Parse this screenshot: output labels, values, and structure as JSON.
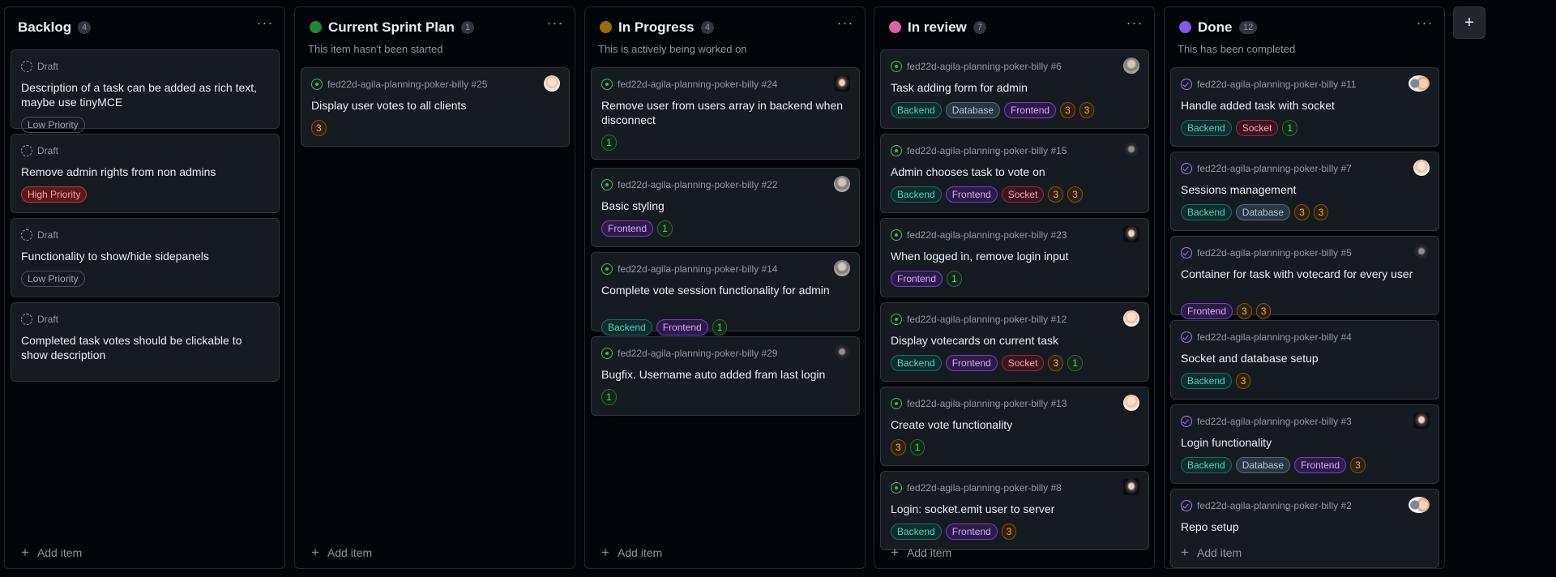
{
  "add_column_label": "+",
  "columns": [
    {
      "title": "Backlog",
      "count": "4",
      "description": "",
      "color": "",
      "menu_label": "···",
      "add_label": "Add item",
      "cards": [
        {
          "status": "draft",
          "meta": "Draft",
          "title": "Description of a task can be added as rich text, maybe use tinyMCE",
          "labels": [
            {
              "text": "Low Priority",
              "kind": "low"
            }
          ]
        },
        {
          "status": "draft",
          "meta": "Draft",
          "title": "Remove admin rights from non admins",
          "labels": [
            {
              "text": "High Priority",
              "kind": "high"
            }
          ]
        },
        {
          "status": "draft",
          "meta": "Draft",
          "title": "Functionality to show/hide sidepanels",
          "labels": [
            {
              "text": "Low Priority",
              "kind": "low"
            }
          ]
        },
        {
          "status": "draft",
          "meta": "Draft",
          "title": "Completed task votes should be clickable to show description",
          "labels": []
        }
      ]
    },
    {
      "title": "Current Sprint Plan",
      "count": "1",
      "description": "This item hasn't been started",
      "color": "#238636",
      "menu_label": "···",
      "add_label": "Add item",
      "cards": [
        {
          "status": "open",
          "meta": "fed22d-agila-planning-poker-billy #25",
          "title": "Display user votes to all clients",
          "avatar": "av-light",
          "labels": [
            {
              "text": "3",
              "kind": "num-orange"
            }
          ]
        }
      ]
    },
    {
      "title": "In Progress",
      "count": "4",
      "description": "This is actively being worked on",
      "color": "#9e6a03",
      "menu_label": "···",
      "add_label": "Add item",
      "cards": [
        {
          "status": "open",
          "meta": "fed22d-agila-planning-poker-billy #24",
          "title": "Remove user from users array in backend when disconnect",
          "avatar": "av-portrait",
          "labels": [
            {
              "text": "1",
              "kind": "num-green"
            }
          ]
        },
        {
          "status": "open",
          "meta": "fed22d-agila-planning-poker-billy #22",
          "title": "Basic styling",
          "avatar": "av-gray",
          "labels": [
            {
              "text": "Frontend",
              "kind": "frontend"
            },
            {
              "text": "1",
              "kind": "num-green"
            }
          ]
        },
        {
          "status": "open",
          "meta": "fed22d-agila-planning-poker-billy #14",
          "title": "Complete vote session functionality for admin",
          "avatar": "av-gray",
          "labels": [
            {
              "text": "Backend",
              "kind": "backend"
            },
            {
              "text": "Frontend",
              "kind": "frontend"
            },
            {
              "text": "1",
              "kind": "num-green"
            }
          ]
        },
        {
          "status": "open",
          "meta": "fed22d-agila-planning-poker-billy #29",
          "title": "Bugfix. Username auto added fram last login",
          "avatar": "av-dark",
          "labels": [
            {
              "text": "1",
              "kind": "num-green"
            }
          ]
        }
      ]
    },
    {
      "title": "In review",
      "count": "7",
      "description": "",
      "color": "#db61a2",
      "menu_label": "···",
      "add_label": "Add item",
      "cards": [
        {
          "status": "open",
          "meta": "fed22d-agila-planning-poker-billy #6",
          "title": "Task adding form for admin",
          "avatar": "av-gray",
          "labels": [
            {
              "text": "Backend",
              "kind": "backend"
            },
            {
              "text": "Database",
              "kind": "database"
            },
            {
              "text": "Frontend",
              "kind": "frontend"
            },
            {
              "text": "3",
              "kind": "num-orange"
            },
            {
              "text": "3",
              "kind": "num-orange"
            }
          ]
        },
        {
          "status": "open",
          "meta": "fed22d-agila-planning-poker-billy #15",
          "title": "Admin chooses task to vote on",
          "avatar": "av-dark",
          "labels": [
            {
              "text": "Backend",
              "kind": "backend"
            },
            {
              "text": "Frontend",
              "kind": "frontend"
            },
            {
              "text": "Socket",
              "kind": "socket"
            },
            {
              "text": "3",
              "kind": "num-orange"
            },
            {
              "text": "3",
              "kind": "num-orange"
            }
          ]
        },
        {
          "status": "open",
          "meta": "fed22d-agila-planning-poker-billy #23",
          "title": "When logged in, remove login input",
          "avatar": "av-portrait",
          "labels": [
            {
              "text": "Frontend",
              "kind": "frontend"
            },
            {
              "text": "1",
              "kind": "num-green"
            }
          ]
        },
        {
          "status": "open",
          "meta": "fed22d-agila-planning-poker-billy #12",
          "title": "Display votecards on current task",
          "avatar": "av-light",
          "labels": [
            {
              "text": "Backend",
              "kind": "backend"
            },
            {
              "text": "Frontend",
              "kind": "frontend"
            },
            {
              "text": "Socket",
              "kind": "socket"
            },
            {
              "text": "3",
              "kind": "num-orange"
            },
            {
              "text": "1",
              "kind": "num-green"
            }
          ]
        },
        {
          "status": "open",
          "meta": "fed22d-agila-planning-poker-billy #13",
          "title": "Create vote functionality",
          "avatar": "av-light",
          "labels": [
            {
              "text": "3",
              "kind": "num-orange"
            },
            {
              "text": "1",
              "kind": "num-green"
            }
          ]
        },
        {
          "status": "open",
          "meta": "fed22d-agila-planning-poker-billy #8",
          "title": "Login: socket.emit user to server",
          "avatar": "av-portrait",
          "labels": [
            {
              "text": "Backend",
              "kind": "backend"
            },
            {
              "text": "Frontend",
              "kind": "frontend"
            },
            {
              "text": "3",
              "kind": "num-orange"
            }
          ]
        }
      ]
    },
    {
      "title": "Done",
      "count": "12",
      "description": "This has been completed",
      "color": "#8957e5",
      "menu_label": "···",
      "add_label": "Add item",
      "cards": [
        {
          "status": "done",
          "meta": "fed22d-agila-planning-poker-billy #11",
          "title": "Handle added task with socket",
          "avatar": "av-pair",
          "labels": [
            {
              "text": "Backend",
              "kind": "backend"
            },
            {
              "text": "Socket",
              "kind": "socket"
            },
            {
              "text": "1",
              "kind": "num-green"
            }
          ]
        },
        {
          "status": "done",
          "meta": "fed22d-agila-planning-poker-billy #7",
          "title": "Sessions management",
          "avatar": "av-light",
          "labels": [
            {
              "text": "Backend",
              "kind": "backend"
            },
            {
              "text": "Database",
              "kind": "database"
            },
            {
              "text": "3",
              "kind": "num-orange"
            },
            {
              "text": "3",
              "kind": "num-orange"
            }
          ]
        },
        {
          "status": "done",
          "meta": "fed22d-agila-planning-poker-billy #5",
          "title": "Container for task with votecard for every user",
          "avatar": "av-dark",
          "labels": [
            {
              "text": "Frontend",
              "kind": "frontend"
            },
            {
              "text": "3",
              "kind": "num-orange"
            },
            {
              "text": "3",
              "kind": "num-orange"
            }
          ]
        },
        {
          "status": "done",
          "meta": "fed22d-agila-planning-poker-billy #4",
          "title": "Socket and database setup",
          "labels": [
            {
              "text": "Backend",
              "kind": "backend"
            },
            {
              "text": "3",
              "kind": "num-orange"
            }
          ]
        },
        {
          "status": "done",
          "meta": "fed22d-agila-planning-poker-billy #3",
          "title": "Login functionality",
          "avatar": "av-portrait",
          "labels": [
            {
              "text": "Backend",
              "kind": "backend"
            },
            {
              "text": "Database",
              "kind": "database"
            },
            {
              "text": "Frontend",
              "kind": "frontend"
            },
            {
              "text": "3",
              "kind": "num-orange"
            }
          ]
        },
        {
          "status": "done",
          "meta": "fed22d-agila-planning-poker-billy #2",
          "title": "Repo setup",
          "avatar": "av-pair",
          "labels": []
        }
      ]
    }
  ]
}
